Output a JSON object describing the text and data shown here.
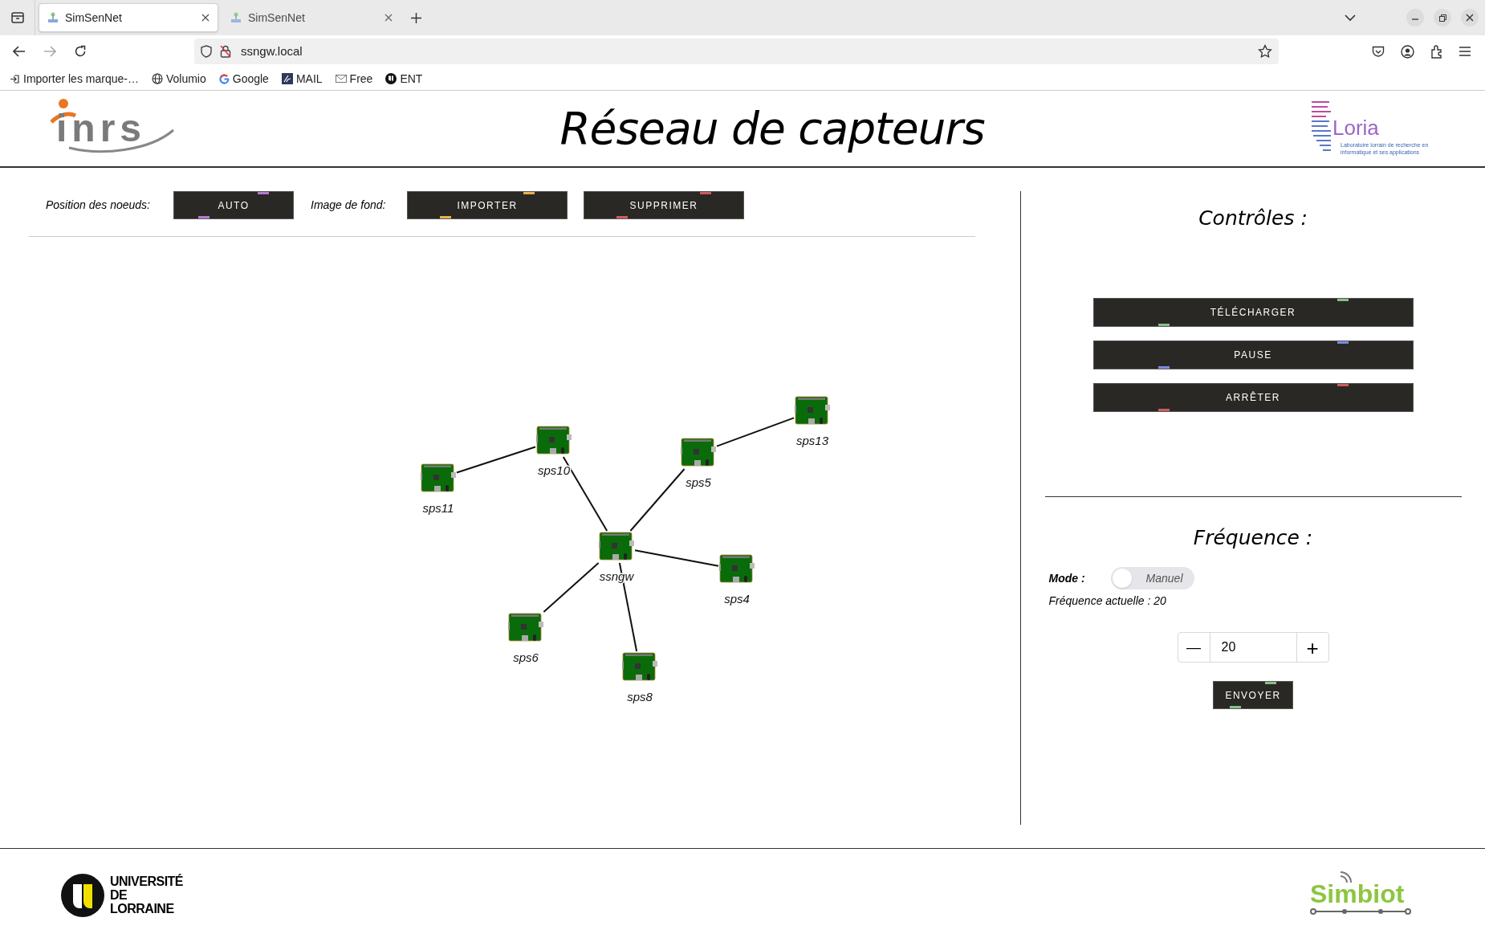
{
  "browser": {
    "tabs": [
      {
        "title": "SimSenNet",
        "selected": true
      },
      {
        "title": "SimSenNet",
        "selected": false
      }
    ],
    "url": "ssngw.local",
    "bookmarks": [
      {
        "label": "Importer les marque-…",
        "kind": "import"
      },
      {
        "label": "Volumio",
        "kind": "globe"
      },
      {
        "label": "Google",
        "kind": "google"
      },
      {
        "label": "MAIL",
        "kind": "mail"
      },
      {
        "label": "Free",
        "kind": "free"
      },
      {
        "label": "ENT",
        "kind": "ent"
      }
    ]
  },
  "header": {
    "left_logo": "inrs",
    "title": "Réseau de capteurs",
    "right_logo": {
      "name": "Loria",
      "tagline": "Laboratoire lorrain de recherche en informatique et ses applications"
    }
  },
  "toolbar": {
    "node_position": {
      "label": "Position des noeuds:",
      "button": {
        "label": "AUTO",
        "color": "#b57ad0"
      }
    },
    "background_image": {
      "label": "Image de fond:",
      "buttons": [
        {
          "label": "IMPORTER",
          "color": "#e9b04e"
        },
        {
          "label": "SUPPRIMER",
          "color": "#d05a60"
        }
      ]
    }
  },
  "network": {
    "name": "ssngw",
    "children": [
      {
        "name": "sps10",
        "children": [
          {
            "name": "sps11"
          }
        ]
      },
      {
        "name": "sps5",
        "children": [
          {
            "name": "sps13"
          }
        ]
      },
      {
        "name": "sps4"
      },
      {
        "name": "sps8"
      },
      {
        "name": "sps6"
      }
    ]
  },
  "controls": {
    "title": "Contrôles :",
    "buttons": [
      {
        "label": "TÉLÉCHARGER",
        "color": "#86c086"
      },
      {
        "label": "PAUSE",
        "color": "#7d88e0"
      },
      {
        "label": "ARRÊTER",
        "color": "#d05a60"
      }
    ]
  },
  "frequency": {
    "title": "Fréquence :",
    "mode_label": "Mode :",
    "mode_toggle": {
      "label": "Manuel",
      "on": false
    },
    "current": "Fréquence actuelle : 20",
    "stepper": {
      "minus": "—",
      "value": "20",
      "plus": "+"
    },
    "send": {
      "label": "ENVOYER",
      "color": "#86c086"
    }
  },
  "footer": {
    "left_logo": "UNIVERSITÉ DE LORRAINE",
    "right_logo": "Simbiot"
  }
}
